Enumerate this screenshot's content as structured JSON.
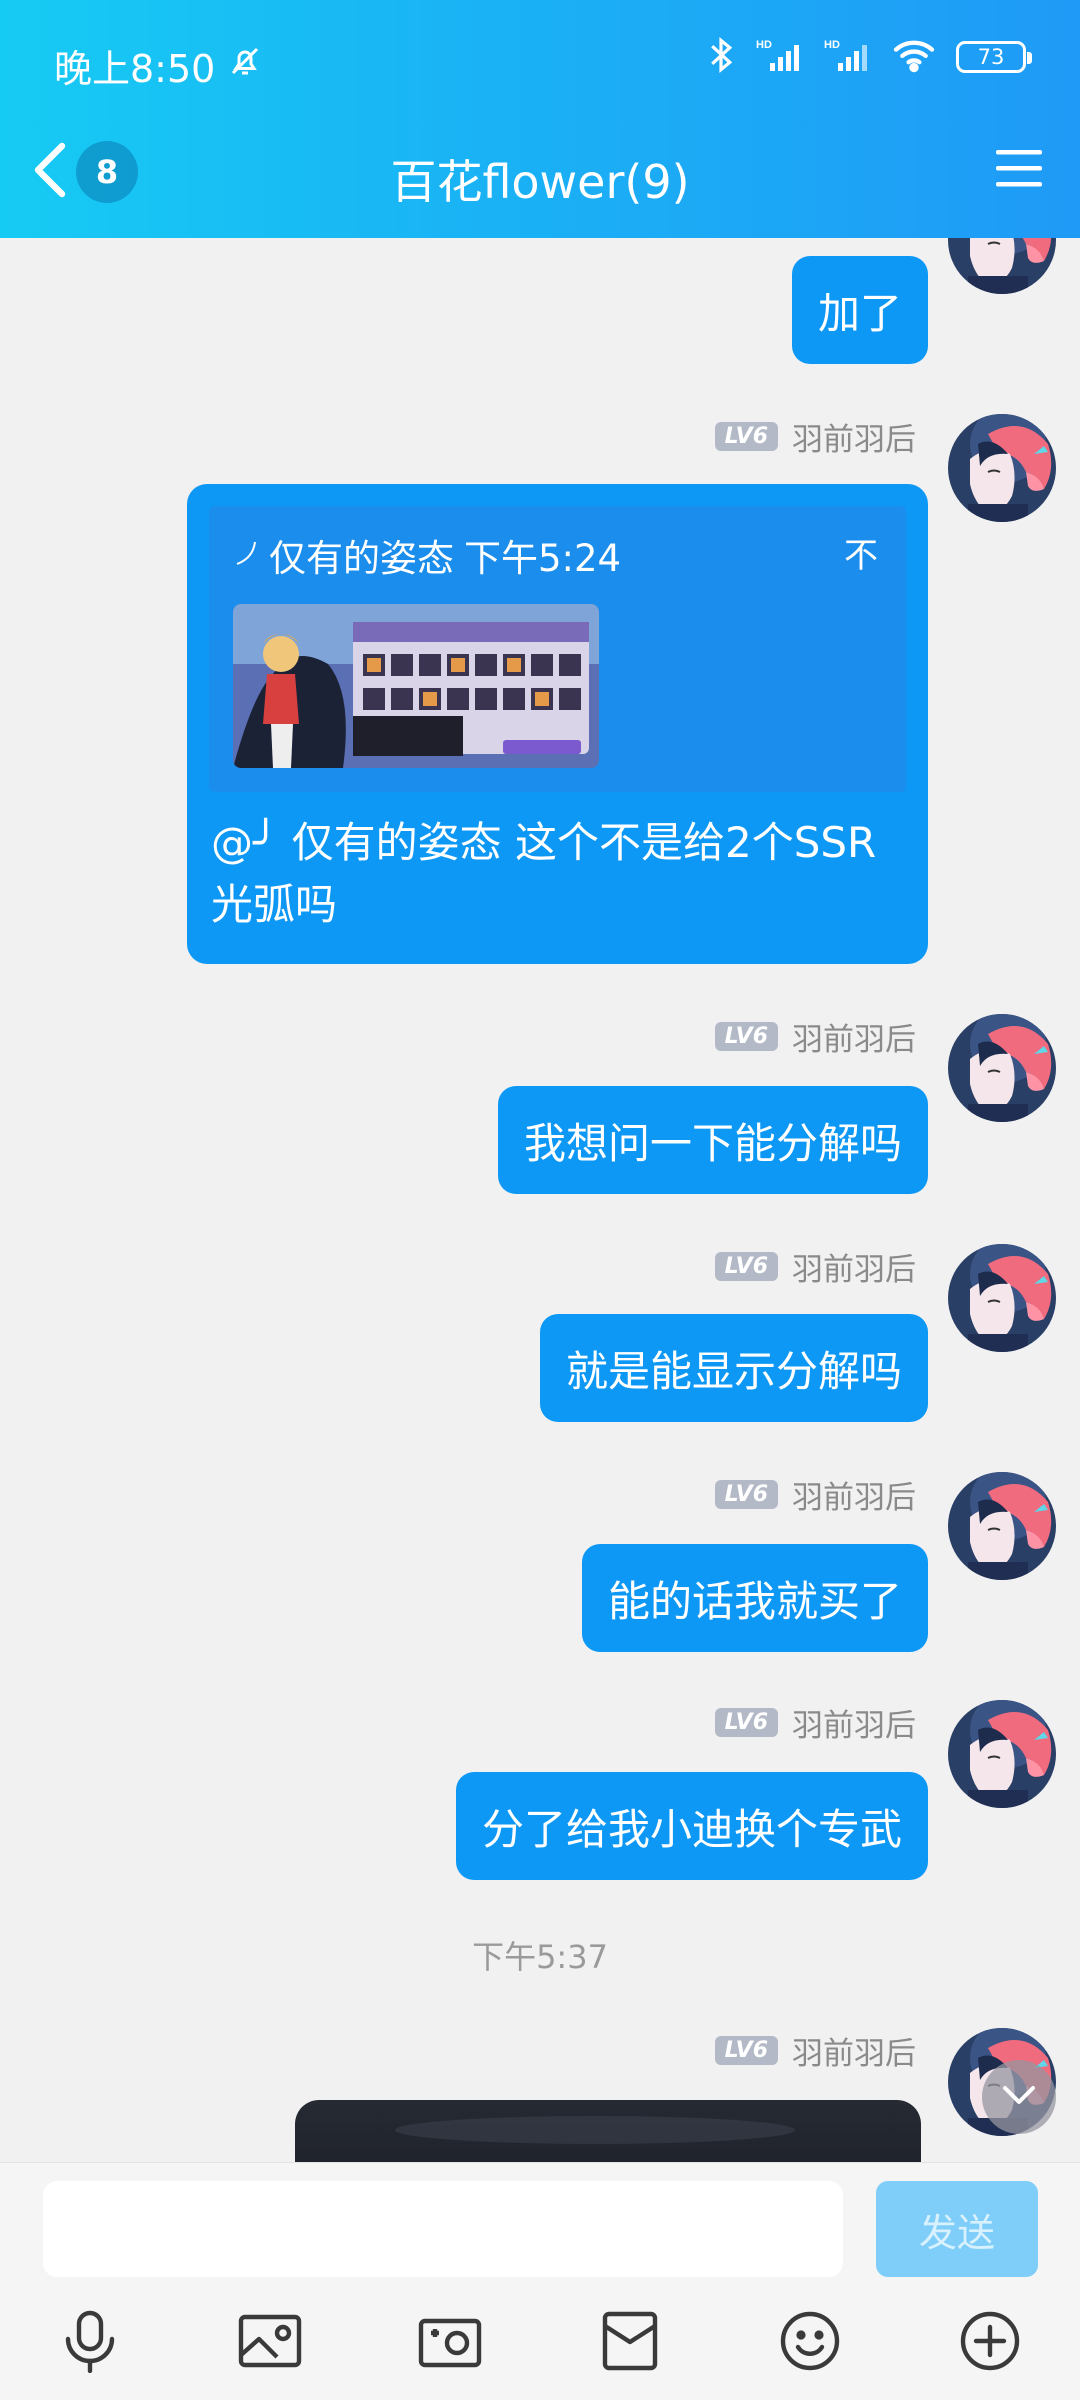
{
  "status_bar": {
    "time": "晚上8:50",
    "battery": "73"
  },
  "nav": {
    "unread_count": "8",
    "title": "百花flower(9)"
  },
  "sender": {
    "level": "LV6",
    "name": "羽前羽后"
  },
  "messages": {
    "m0": "加了",
    "reply": {
      "quote_author": "仅有的姿态",
      "quote_time": "下午5:24",
      "quote_trailing": "不",
      "text": "@╯ 仅有的姿态 这个不是给2个SSR光弧吗"
    },
    "m2": "我想问一下能分解吗",
    "m3": "就是能显示分解吗",
    "m4": "能的话我就买了",
    "m5": "分了给我小迪换个专武"
  },
  "time_separator": "下午5:37",
  "input": {
    "value": "",
    "send_label": "发送"
  },
  "colors": {
    "header_start": "#16cbf3",
    "header_end": "#1f9af6",
    "bubble": "#0e98f5"
  },
  "icons": [
    "microphone-icon",
    "image-icon",
    "camera-icon",
    "red-packet-icon",
    "emoji-icon",
    "plus-icon"
  ]
}
